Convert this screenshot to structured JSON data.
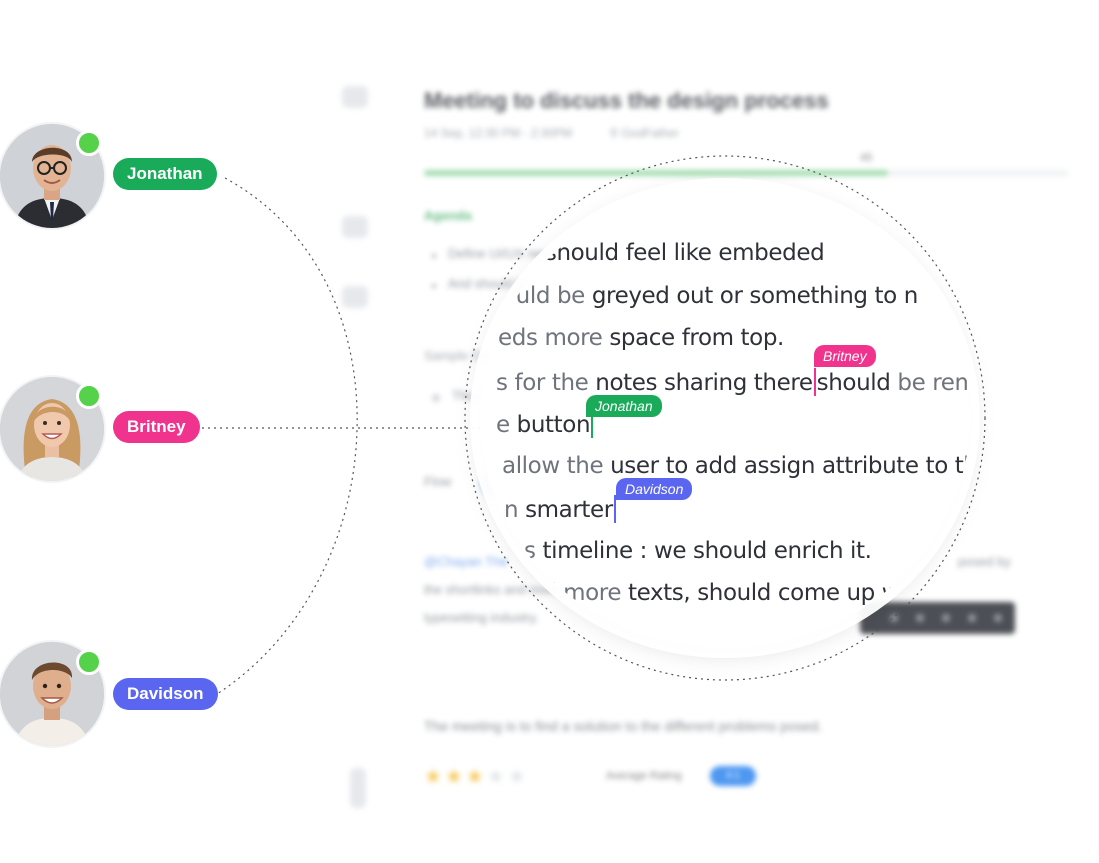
{
  "document": {
    "title": "Meeting to discuss the design process",
    "time": "14 Sep, 12:30 PM - 2:30PM",
    "location": "GodFather",
    "progress_label": "45",
    "progress_pct": 72,
    "agenda_heading": "Agenda",
    "agenda_items": [
      "Define UI/UX need should feel like embeded",
      "And should be greyed out or something to"
    ],
    "sample_heading": "Sample Dis",
    "sample_item": "Thoughts",
    "flow_label": "Flow",
    "mention_text": "@Chayan  The",
    "side_text": "posed by",
    "body_line_2": "the shortlinks and more texts,",
    "body_line_3": "typesetting industry.",
    "description": "The meeting is to find a solution to the different problems posed.",
    "rating_label": "Average Rating",
    "rating_value": "4.1",
    "stars_filled": 3,
    "stars_total": 5
  },
  "collaborators": [
    {
      "name": "Jonathan",
      "color": "#1aab5a",
      "online": true
    },
    {
      "name": "Britney",
      "color": "#f0338d",
      "online": true
    },
    {
      "name": "Davidson",
      "color": "#5b66f0",
      "online": true
    }
  ],
  "magnifier": {
    "lines": [
      {
        "pre": "ed",
        "text": " should feel like embeded"
      },
      {
        "pre": "ould be",
        "text": " greyed out  or something to n"
      },
      {
        "pre": "eds more",
        "text": " space from top."
      },
      {
        "pre": "s for the",
        "text_a": " notes sharing there",
        "text_b": "should",
        "text_c": " be rem"
      },
      {
        "pre": "e",
        "text": " button"
      },
      {
        "pre": "allow the",
        "text": " user to add assign attribute to th"
      },
      {
        "pre": "n",
        "text": " smarter"
      },
      {
        "pre": "s",
        "text": " timeline : we should enrich it."
      },
      {
        "pre": "d more",
        "text": " texts,  should come up wi"
      }
    ],
    "cursor_labels": {
      "britney": "Britney",
      "jonathan": "Jonathan",
      "davidson": "Davidson"
    }
  }
}
